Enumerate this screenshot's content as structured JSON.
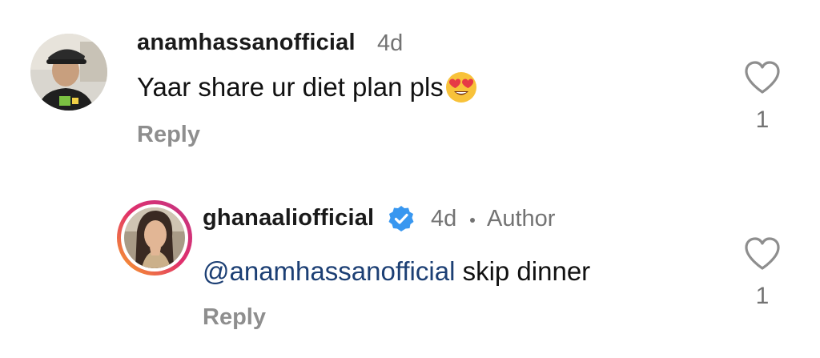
{
  "comments": [
    {
      "username": "anamhassanofficial",
      "time": "4d",
      "text": "Yaar share ur diet plan pls",
      "emoji_icon": "heart-eyes-emoji",
      "reply_label": "Reply",
      "like_count": "1",
      "like_icon": "heart-outline-icon"
    }
  ],
  "replies": [
    {
      "username": "ghanaaliofficial",
      "verified_icon": "verified-badge-icon",
      "time": "4d",
      "author_label": "Author",
      "mention": "@anamhassanofficial",
      "text": "skip dinner",
      "reply_label": "Reply",
      "like_count": "1",
      "like_icon": "heart-outline-icon"
    }
  ],
  "colors": {
    "mention": "#1c3f74",
    "muted": "#737373",
    "reply": "#8e8e8e",
    "verified": "#3897f0",
    "story_ring": [
      "#f9a825",
      "#e1306c",
      "#c13584"
    ]
  }
}
